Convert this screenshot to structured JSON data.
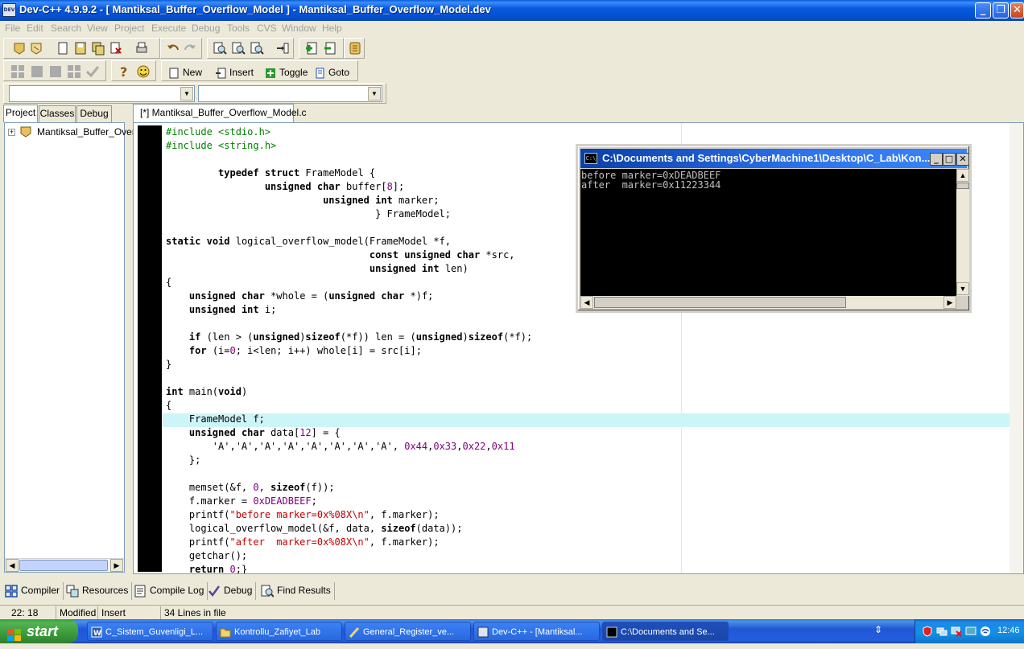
{
  "window": {
    "title": "Dev-C++ 4.9.9.2  - [ Mantiksal_Buffer_Overflow_Model ] - Mantiksal_Buffer_Overflow_Model.dev",
    "app_icon_text": "DEV",
    "controls": {
      "minimize": "_",
      "restore": "❐",
      "close": "✕"
    }
  },
  "menu": [
    "File",
    "Edit",
    "Search",
    "View",
    "Project",
    "Execute",
    "Debug",
    "Tools",
    "CVS",
    "Window",
    "Help"
  ],
  "toolbar2": {
    "new_label": "New",
    "insert_label": "Insert",
    "toggle_label": "Toggle",
    "goto_label": "Goto"
  },
  "left_panel": {
    "tabs": [
      "Project",
      "Classes",
      "Debug"
    ],
    "active_tab": "Project",
    "tree_root": "Mantiksal_Buffer_Overf",
    "expander": "+"
  },
  "editor": {
    "file_tab": "[*] Mantiksal_Buffer_Overflow_Model.c",
    "lines": [
      "#include <stdio.h>",
      "#include <string.h>",
      "",
      "         typedef struct FrameModel {",
      "                 unsigned char buffer[8];",
      "                           unsigned int marker;",
      "                                    } FrameModel;",
      "",
      "static void logical_overflow_model(FrameModel *f,",
      "                                   const unsigned char *src,",
      "                                   unsigned int len)",
      "{",
      "    unsigned char *whole = (unsigned char *)f;",
      "    unsigned int i;",
      "",
      "    if (len > (unsigned)sizeof(*f)) len = (unsigned)sizeof(*f);",
      "    for (i=0; i<len; i++) whole[i] = src[i];",
      "}",
      "",
      "int main(void)",
      "{",
      "    FrameModel f;",
      "    unsigned char data[12] = {",
      "        'A','A','A','A','A','A','A','A', 0x44,0x33,0x22,0x11",
      "    };",
      "",
      "    memset(&f, 0, sizeof(f));",
      "    f.marker = 0xDEADBEEF;",
      "    printf(\"before marker=0x%08X\\n\", f.marker);",
      "    logical_overflow_model(&f, data, sizeof(data));",
      "    printf(\"after  marker=0x%08X\\n\", f.marker);",
      "    getchar();",
      "    return 0;}"
    ],
    "active_line": 22
  },
  "console": {
    "title": "C:\\Documents and Settings\\CyberMachine1\\Desktop\\C_Lab\\Kon...",
    "icon_text": "C:\\",
    "output": [
      "before marker=0xDEADBEEF",
      "after  marker=0x11223344"
    ],
    "controls": {
      "minimize": "_",
      "maximize": "□",
      "close": "✕"
    }
  },
  "bottom_tabs": [
    "Compiler",
    "Resources",
    "Compile Log",
    "Debug",
    "Find Results"
  ],
  "status": {
    "position": "22: 18",
    "state": "Modified",
    "mode": "Insert",
    "lines": "34 Lines in file"
  },
  "taskbar": {
    "start": "start",
    "tasks": [
      {
        "label": "C_Sistem_Guvenligi_L...",
        "active": false
      },
      {
        "label": "Kontrollu_Zafiyet_Lab",
        "active": false
      },
      {
        "label": "General_Register_ve...",
        "active": false
      },
      {
        "label": "Dev-C++ - [Mantiksal...",
        "active": false
      },
      {
        "label": "C:\\Documents and Se...",
        "active": true
      }
    ],
    "clock": "12:46"
  },
  "colors": {
    "accent": "#0a5fd8",
    "console_bg": "#000000",
    "active_line": "#ccf5f8",
    "keyword_number": "#800080",
    "string": "#c00000",
    "preprocessor": "#008000"
  }
}
